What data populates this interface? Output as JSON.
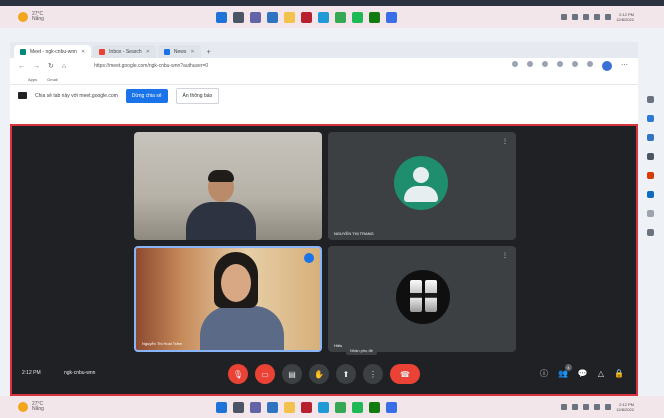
{
  "taskbar": {
    "weather_temp": "27°C",
    "weather_desc": "Nắng",
    "clock_time": "2:12 PM",
    "clock_date": "12/8/2022",
    "apps": [
      "windows",
      "search",
      "chat",
      "explorer",
      "folder",
      "office",
      "edge",
      "chrome",
      "spotify",
      "xbox",
      "store"
    ]
  },
  "browser": {
    "tabs": [
      {
        "label": "Meet - ngk-cnbu-wnn",
        "active": true
      },
      {
        "label": "Inbox - Search",
        "active": false
      },
      {
        "label": "News",
        "active": false
      }
    ],
    "url": "https://meet.google.com/ngk-cnbu-wnn?authuser=0",
    "bookmarks": [
      "Apps",
      "Gmail"
    ],
    "infobar": {
      "text": "Chia sẻ tab này với meet.google.com",
      "stop_label": "Dừng chia sẻ",
      "hide_label": "Ẩn thông báo"
    }
  },
  "meet": {
    "participants": [
      {
        "name": "",
        "video": true
      },
      {
        "name": "NGUYỄN THỊ TRANG",
        "video": false
      },
      {
        "name": "Nguyễn Thị Hoài Trâm",
        "video": true,
        "speaking": true
      },
      {
        "name": "Hiếu",
        "video": false
      }
    ],
    "time": "2:12 PM",
    "meeting_code": "ngk-cnbu-wnn",
    "tooltip": "Nhận phụ đề",
    "participant_count": "4",
    "colors": {
      "end_call": "#ea4335",
      "accent": "#1a73e8",
      "bg": "#202124"
    }
  }
}
